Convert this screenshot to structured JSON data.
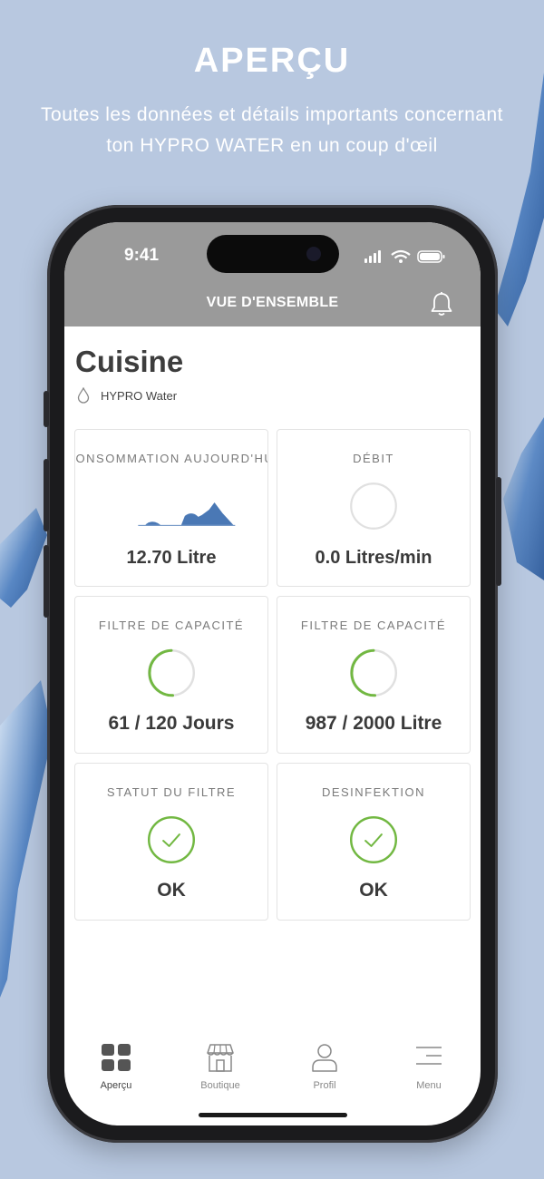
{
  "promo": {
    "title": "APERÇU",
    "subtitle": "Toutes les données et détails importants concernant ton HYPRO WATER en un coup d'œil"
  },
  "status_bar": {
    "time": "9:41"
  },
  "header": {
    "title": "VUE D'ENSEMBLE",
    "icon": "bell-icon"
  },
  "page": {
    "title": "Cuisine",
    "device_name": "HYPRO Water",
    "device_icon": "water-drop-icon"
  },
  "cards": [
    {
      "title": "CONSOMMATION AUJOURD'HUI",
      "value": "12.70 Litre",
      "visual": "area-chart"
    },
    {
      "title": "DÉBIT",
      "value": "0.0 Litres/min",
      "visual": "ring",
      "fill": 0
    },
    {
      "title": "FILTRE DE CAPACITÉ",
      "value": "61 / 120 Jours",
      "visual": "ring",
      "fill": 0.49
    },
    {
      "title": "FILTRE DE CAPACITÉ",
      "value": "987 / 2000 Litre",
      "visual": "ring",
      "fill": 0.49
    },
    {
      "title": "STATUT DU FILTRE",
      "value": "OK",
      "visual": "check"
    },
    {
      "title": "DESINFEKTION",
      "value": "OK",
      "visual": "check"
    }
  ],
  "tabs": [
    {
      "label": "Aperçu",
      "icon": "grid-icon",
      "active": true
    },
    {
      "label": "Boutique",
      "icon": "shop-icon",
      "active": false
    },
    {
      "label": "Profil",
      "icon": "user-icon",
      "active": false
    },
    {
      "label": "Menu",
      "icon": "menu-icon",
      "active": false
    }
  ],
  "colors": {
    "background": "#b8c8e0",
    "header": "#9a9a9a",
    "accent_green": "#72b842",
    "chart_blue": "#4a78b5",
    "ring_grey": "#e0e0e0"
  }
}
